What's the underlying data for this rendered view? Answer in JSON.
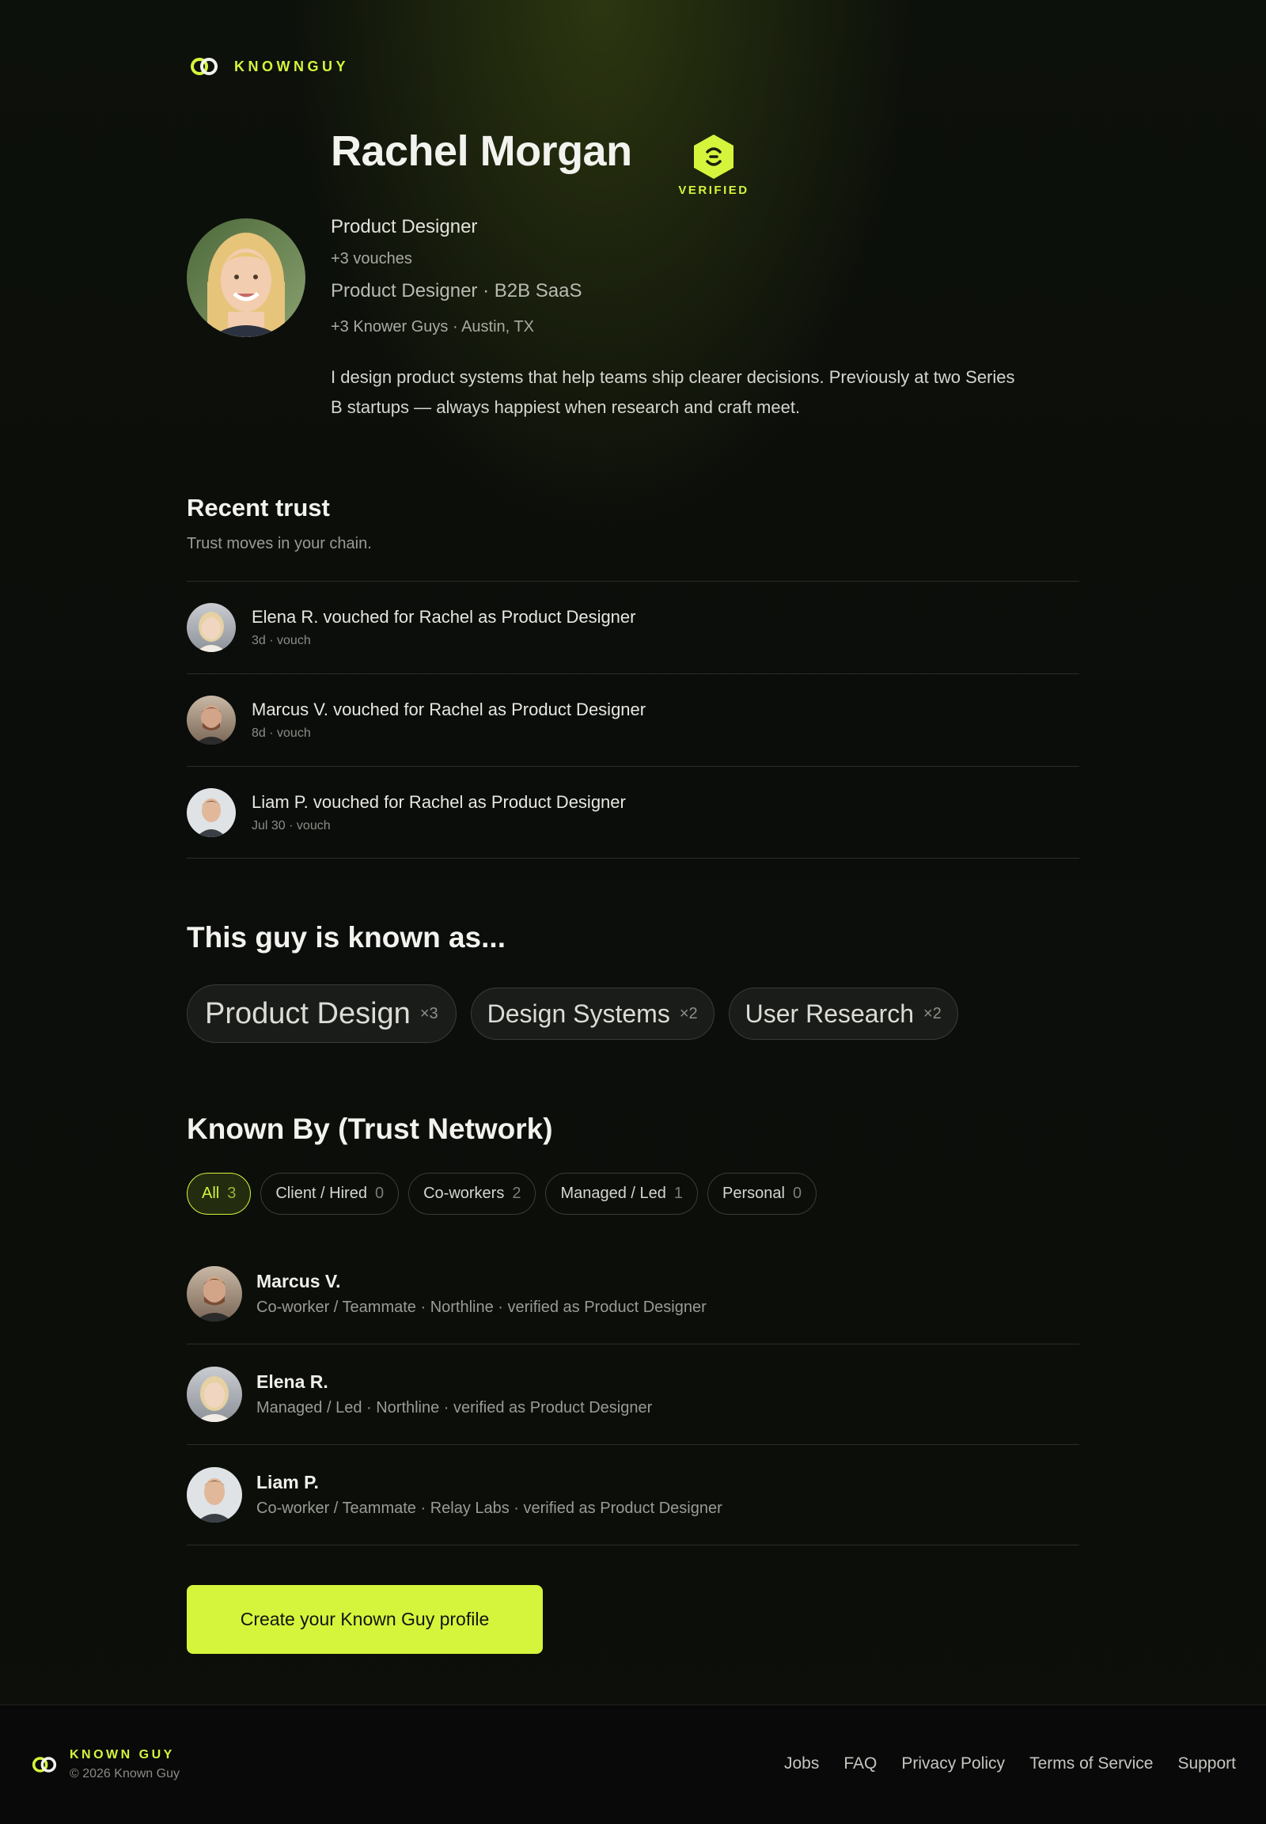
{
  "brand": {
    "name": "KNOWNGUY"
  },
  "profile": {
    "name": "Rachel Morgan",
    "verified_label": "VERIFIED",
    "role": "Product Designer",
    "vouches": "+3 vouches",
    "subtitle": "Product Designer · B2B SaaS",
    "meta": "+3 Knower Guys · Austin, TX",
    "bio": "I design product systems that help teams ship clearer decisions. Previously at two Series B startups — always happiest when research and craft meet."
  },
  "recent_trust": {
    "title": "Recent trust",
    "subtitle": "Trust moves in your chain.",
    "items": [
      {
        "text": "Elena R. vouched for Rachel as Product Designer",
        "meta": "3d · vouch"
      },
      {
        "text": "Marcus V. vouched for Rachel as Product Designer",
        "meta": "8d · vouch"
      },
      {
        "text": "Liam P. vouched for Rachel as Product Designer",
        "meta": "Jul 30 · vouch"
      }
    ]
  },
  "known_as": {
    "title": "This guy is known as...",
    "tags": [
      {
        "label": "Product Design",
        "count": "×3"
      },
      {
        "label": "Design Systems",
        "count": "×2"
      },
      {
        "label": "User Research",
        "count": "×2"
      }
    ]
  },
  "known_by": {
    "title": "Known By (Trust Network)",
    "filters": [
      {
        "label": "All",
        "count": "3"
      },
      {
        "label": "Client / Hired",
        "count": "0"
      },
      {
        "label": "Co-workers",
        "count": "2"
      },
      {
        "label": "Managed / Led",
        "count": "1"
      },
      {
        "label": "Personal",
        "count": "0"
      }
    ],
    "people": [
      {
        "name": "Marcus V.",
        "meta": "Co-worker / Teammate · Northline · verified as Product Designer"
      },
      {
        "name": "Elena R.",
        "meta": "Managed / Led · Northline · verified as Product Designer"
      },
      {
        "name": "Liam P.",
        "meta": "Co-worker / Teammate · Relay Labs · verified as Product Designer"
      }
    ]
  },
  "cta": {
    "label": "Create your Known Guy profile"
  },
  "footer": {
    "brand": "KNOWN GUY",
    "copyright": "© 2026 Known Guy",
    "links": [
      "Jobs",
      "FAQ",
      "Privacy Policy",
      "Terms of Service",
      "Support"
    ]
  },
  "colors": {
    "accent": "#d4f53c",
    "background": "#0b0d0a"
  },
  "icons": {
    "brand": "link-logo-icon",
    "verified": "hexagon-badge-icon"
  }
}
